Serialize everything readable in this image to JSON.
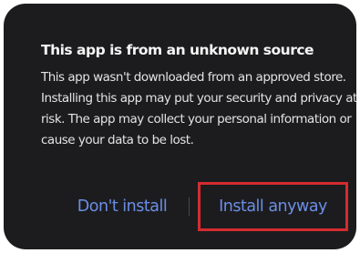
{
  "dialog": {
    "title": "This app is from an unknown source",
    "message": "This app wasn't downloaded from an approved store. Installing this app may put your security and privacy at risk. The app may collect your personal information or cause your data to be lost.",
    "cancel_label": "Don't install",
    "confirm_label": "Install anyway"
  },
  "colors": {
    "background": "#1c1c1e",
    "title_text": "#f5f5f5",
    "message_text": "#e3e3e3",
    "button_text": "#6b8ee6",
    "highlight_border": "#d42b2f"
  }
}
